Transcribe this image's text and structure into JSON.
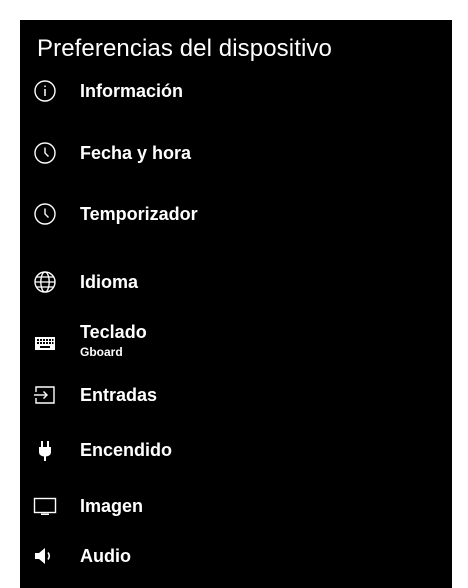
{
  "title": "Preferencias del dispositivo",
  "items": [
    {
      "label": "Información",
      "icon": "info-icon"
    },
    {
      "label": "Fecha y hora",
      "icon": "clock-icon"
    },
    {
      "label": "Temporizador",
      "icon": "clock-icon"
    },
    {
      "label": "Idioma",
      "icon": "globe-icon"
    },
    {
      "label": "Teclado",
      "sublabel": "Gboard",
      "icon": "keyboard-icon"
    },
    {
      "label": "Entradas",
      "icon": "input-icon"
    },
    {
      "label": "Encendido",
      "icon": "power-plug-icon"
    },
    {
      "label": "Imagen",
      "icon": "display-icon"
    },
    {
      "label": "Audio",
      "icon": "speaker-icon"
    }
  ],
  "colors": {
    "background": "#000000",
    "text": "#ffffff",
    "page": "#ffffff"
  }
}
